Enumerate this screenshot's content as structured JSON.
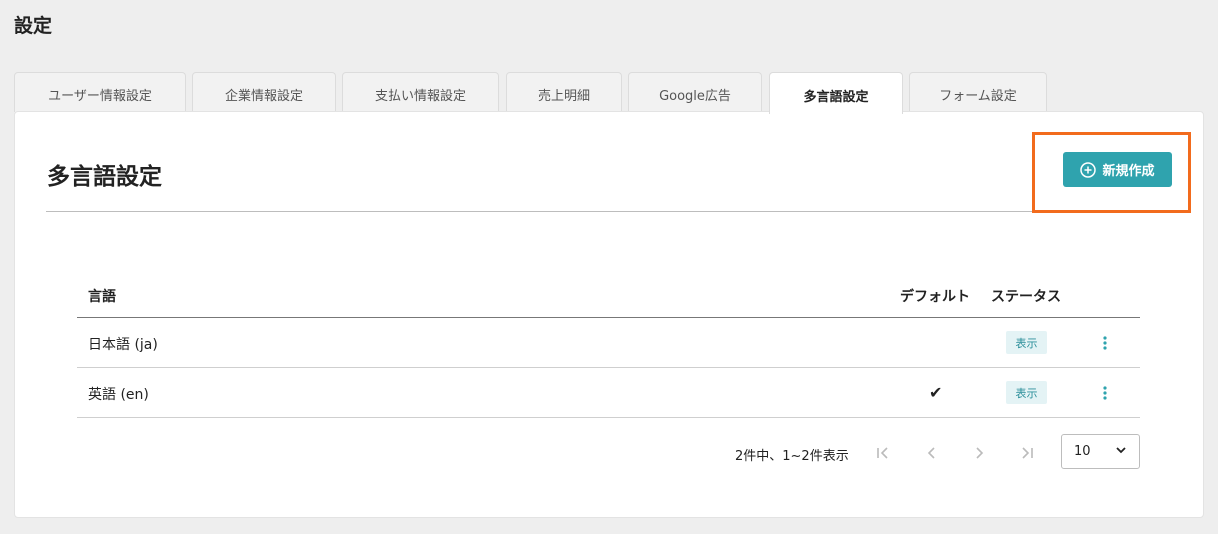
{
  "page": {
    "title": "設定"
  },
  "tabs": [
    {
      "label": "ユーザー情報設定",
      "active": false
    },
    {
      "label": "企業情報設定",
      "active": false
    },
    {
      "label": "支払い情報設定",
      "active": false
    },
    {
      "label": "売上明細",
      "active": false
    },
    {
      "label": "Google広告",
      "active": false
    },
    {
      "label": "多言語設定",
      "active": true
    },
    {
      "label": "フォーム設定",
      "active": false
    }
  ],
  "section": {
    "title": "多言語設定",
    "new_button_label": "新規作成",
    "new_button_icon": "plus-circle-icon"
  },
  "colors": {
    "accent": "#2fa3ae",
    "highlight": "#f26b1d",
    "badge_bg": "#e4f3f5",
    "badge_text": "#2b8f9a"
  },
  "table": {
    "headers": {
      "language": "言語",
      "default": "デフォルト",
      "status": "ステータス"
    },
    "rows": [
      {
        "language": "日本語 (ja)",
        "default": "",
        "status": "表示"
      },
      {
        "language": "英語 (en)",
        "default": "✔",
        "status": "表示"
      }
    ]
  },
  "pagination": {
    "info": "2件中、1~2件表示",
    "page_size": "10"
  }
}
